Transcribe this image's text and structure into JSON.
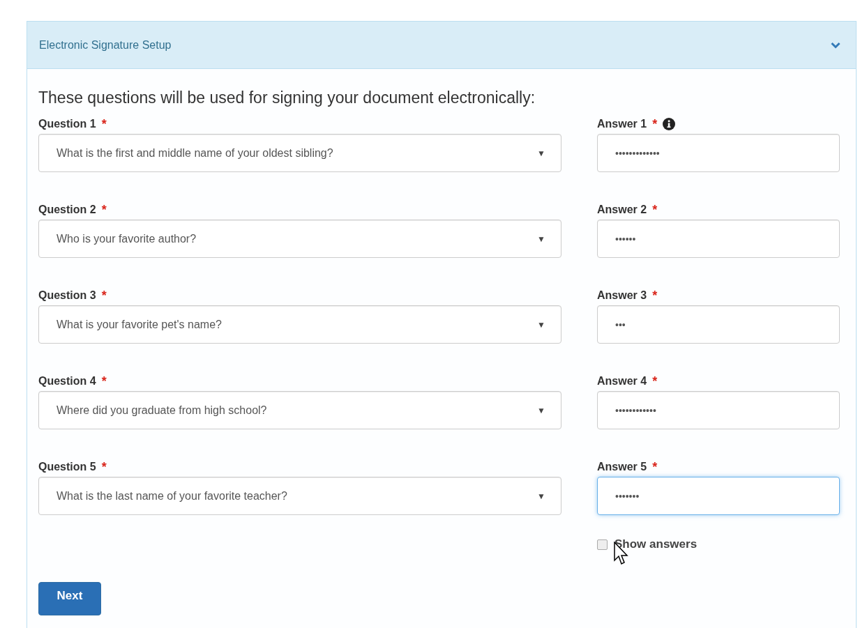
{
  "panel": {
    "title": "Electronic Signature Setup",
    "expanded": true
  },
  "intro": "These questions will be used for signing your document electronically:",
  "rows": [
    {
      "question_label": "Question 1",
      "question": "What is the first and middle name of your oldest sibling?",
      "answer_label": "Answer 1",
      "answer": "•••••••••••••",
      "info": true,
      "focused": false
    },
    {
      "question_label": "Question 2",
      "question": "Who is your favorite author?",
      "answer_label": "Answer 2",
      "answer": "••••••",
      "info": false,
      "focused": false
    },
    {
      "question_label": "Question 3",
      "question": "What is your favorite pet's name?",
      "answer_label": "Answer 3",
      "answer": "•••",
      "info": false,
      "focused": false
    },
    {
      "question_label": "Question 4",
      "question": "Where did you graduate from high school?",
      "answer_label": "Answer 4",
      "answer": "••••••••••••",
      "info": false,
      "focused": false
    },
    {
      "question_label": "Question 5",
      "question": "What is the last name of your favorite teacher?",
      "answer_label": "Answer 5",
      "answer": "•••••••",
      "info": false,
      "focused": true
    }
  ],
  "required_mark": "*",
  "dropdown_caret": "▼",
  "show_answers": {
    "label": "Show answers",
    "checked": false
  },
  "next_button": "Next"
}
